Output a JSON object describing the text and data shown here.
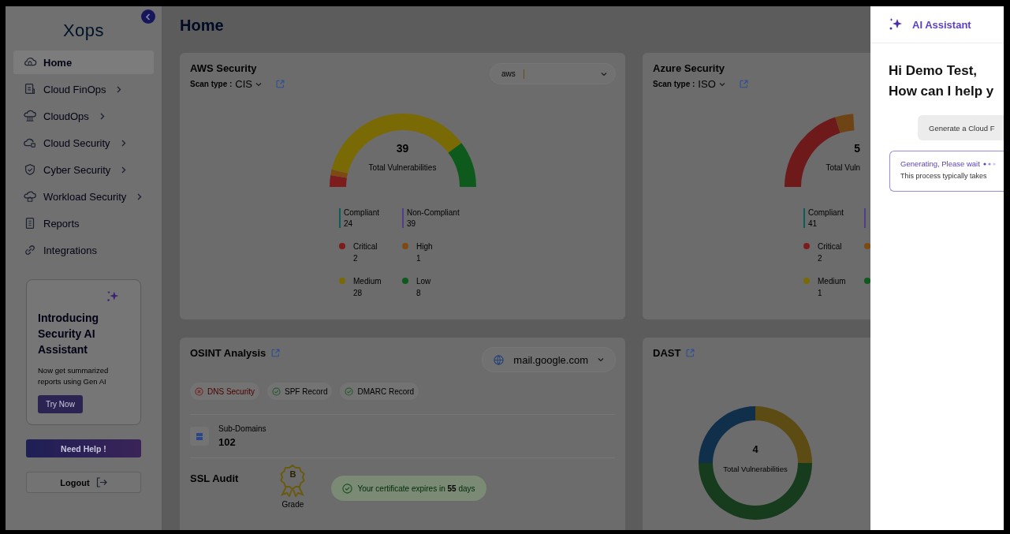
{
  "sidebar": {
    "logo": "Xops",
    "nav": [
      {
        "label": "Home",
        "selected": true,
        "submenu": false
      },
      {
        "label": "Cloud FinOps",
        "selected": false,
        "submenu": true
      },
      {
        "label": "CloudOps",
        "selected": false,
        "submenu": true
      },
      {
        "label": "Cloud Security",
        "selected": false,
        "submenu": true
      },
      {
        "label": "Cyber Security",
        "selected": false,
        "submenu": true
      },
      {
        "label": "Workload Security",
        "selected": false,
        "submenu": true
      },
      {
        "label": "Reports",
        "selected": false,
        "submenu": false
      },
      {
        "label": "Integrations",
        "selected": false,
        "submenu": false
      }
    ],
    "promo": {
      "title": "Introducing Security AI Assistant",
      "text": "Now get summarized reports using Gen AI",
      "button": "Try Now"
    },
    "help_button": "Need Help !",
    "logout_button": "Logout"
  },
  "page_title": "Home",
  "aws": {
    "title": "AWS Security",
    "scan_label": "Scan type :",
    "scan_value": "CIS",
    "account_logo": "aws",
    "total": "39",
    "total_label": "Total Vulnerabilities",
    "compliance": [
      {
        "label": "Compliant",
        "value": "24",
        "color": "#0e5c5a"
      },
      {
        "label": "Non-Compliant",
        "value": "39",
        "color": "#4f3d8c"
      }
    ],
    "severities": [
      {
        "label": "Critical",
        "value": "2",
        "color": "#7d1c1c"
      },
      {
        "label": "High",
        "value": "1",
        "color": "#7d4a14"
      },
      {
        "label": "Medium",
        "value": "28",
        "color": "#7a6a06"
      },
      {
        "label": "Low",
        "value": "8",
        "color": "#0e5a1c"
      }
    ]
  },
  "azure": {
    "title": "Azure Security",
    "scan_label": "Scan type :",
    "scan_value": "ISO",
    "total": "5",
    "total_label": "Total Vuln",
    "compliance": [
      {
        "label": "Compliant",
        "value": "41",
        "color": "#0e5c5a"
      },
      {
        "color": "#4f3d8c"
      }
    ],
    "severities": [
      {
        "label": "Critical",
        "value": "2",
        "color": "#7d1c1c"
      },
      {
        "color": "#7d4a14"
      },
      {
        "label": "Medium",
        "value": "1",
        "color": "#7a6a06"
      },
      {
        "color": "#0e5a1c"
      }
    ]
  },
  "osint": {
    "title": "OSINT Analysis",
    "domain": "mail.google.com",
    "checks": [
      {
        "label": "DNS Security",
        "passed": false
      },
      {
        "label": "SPF Record",
        "passed": true
      },
      {
        "label": "DMARC Record",
        "passed": true
      }
    ],
    "subdomains": {
      "label": "Sub-Domains",
      "value": "102"
    },
    "ssl": {
      "title": "SSL Audit",
      "grade": "B",
      "grade_label": "Grade",
      "expiry": "Your certificate expires in **55** days"
    }
  },
  "dast": {
    "title": "DAST",
    "total": "4",
    "total_label": "Total Vulnerabilities"
  },
  "assistant": {
    "title": "AI Assistant",
    "greeting": [
      "Hi Demo Test,",
      "How can I help y"
    ],
    "suggestion": "Generate a Cloud F",
    "status": "Generating, Please wait",
    "note": "This process typically takes"
  }
}
